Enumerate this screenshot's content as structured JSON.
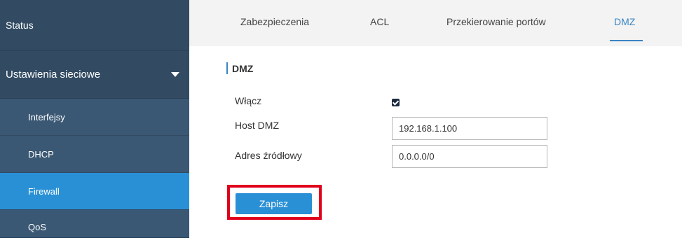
{
  "sidebar": {
    "status": "Status",
    "network_settings": "Ustawienia sieciowe",
    "items": [
      {
        "label": "Interfejsy"
      },
      {
        "label": "DHCP"
      },
      {
        "label": "Firewall"
      },
      {
        "label": "QoS"
      }
    ],
    "active_item": "Firewall"
  },
  "tabs": [
    {
      "label": "Zabezpieczenia"
    },
    {
      "label": "ACL"
    },
    {
      "label": "Przekierowanie portów"
    },
    {
      "label": "DMZ"
    }
  ],
  "active_tab": "DMZ",
  "section": {
    "title": "DMZ"
  },
  "form": {
    "enable_label": "Włącz",
    "enable_checked": true,
    "host_label": "Host DMZ",
    "host_value": "192.168.1.100",
    "source_label": "Adres źródłowy",
    "source_value": "0.0.0.0/0"
  },
  "save_label": "Zapisz",
  "colors": {
    "sidebar_bg": "#324b63",
    "sidebar_sub_bg": "#3a5873",
    "active_bg": "#2a90d6",
    "tab_active": "#3a85c3",
    "highlight": "#e0001b"
  }
}
